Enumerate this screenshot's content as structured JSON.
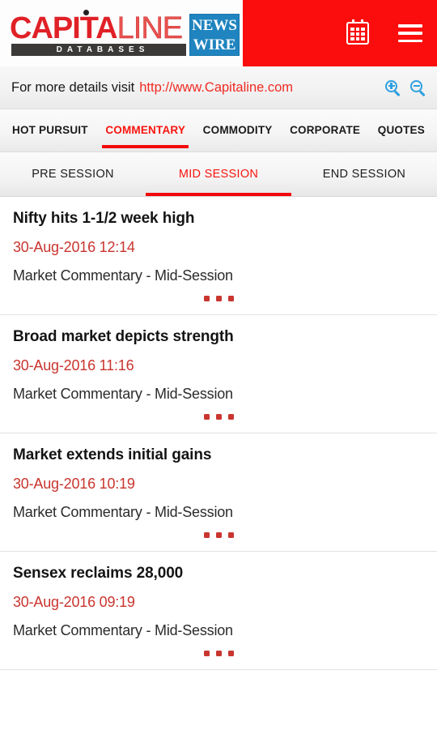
{
  "header": {
    "logo": {
      "brand_bold": "CAPITA",
      "brand_light": "LINE",
      "tagline": "DATABASES",
      "badge_line1": "NEWS",
      "badge_line2": "WIRE"
    },
    "calendar_icon": "calendar-icon",
    "menu_icon": "hamburger-menu-icon",
    "accent_color": "#fc0d0d"
  },
  "infobar": {
    "prefix": "For more details visit",
    "link": "http://www.Capitaline.com",
    "zoom_in_icon": "zoom-in-icon",
    "zoom_out_icon": "zoom-out-icon",
    "icon_color": "#2e9fe0"
  },
  "primary_tabs": [
    {
      "label": "HOT PURSUIT",
      "active": false
    },
    {
      "label": "COMMENTARY",
      "active": true
    },
    {
      "label": "COMMODITY",
      "active": false
    },
    {
      "label": "CORPORATE",
      "active": false
    },
    {
      "label": "QUOTES",
      "active": false
    }
  ],
  "secondary_tabs": [
    {
      "label": "PRE SESSION",
      "active": false
    },
    {
      "label": "MID SESSION",
      "active": true
    },
    {
      "label": "END SESSION",
      "active": false
    }
  ],
  "active_tab_color": "#f8150f",
  "news_items": [
    {
      "title": "Nifty hits 1-1/2 week high",
      "date": "30-Aug-2016 12:14",
      "category": "Market Commentary - Mid-Session",
      "more": "•••"
    },
    {
      "title": "Broad market depicts strength",
      "date": "30-Aug-2016 11:16",
      "category": "Market Commentary - Mid-Session",
      "more": "•••"
    },
    {
      "title": "Market extends initial gains",
      "date": "30-Aug-2016 10:19",
      "category": "Market Commentary - Mid-Session",
      "more": "•••"
    },
    {
      "title": "Sensex reclaims 28,000",
      "date": "30-Aug-2016 09:19",
      "category": "Market Commentary - Mid-Session",
      "more": "•••"
    }
  ]
}
